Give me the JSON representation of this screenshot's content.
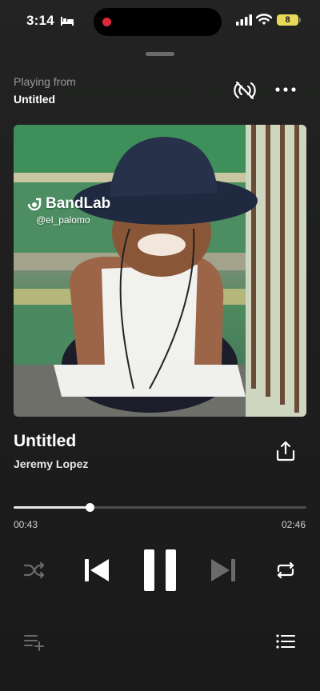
{
  "status_bar": {
    "time": "3:14",
    "battery": "8",
    "icons": [
      "bed-icon",
      "recording-dot",
      "cellular-signal-icon",
      "wifi-icon",
      "battery-icon"
    ]
  },
  "header": {
    "playing_from_label": "Playing from",
    "source_name": "Untitled",
    "icons": [
      "cast-off-icon",
      "more-options-icon"
    ]
  },
  "artwork": {
    "watermark_brand": "BandLab",
    "watermark_handle": "@el_palomo"
  },
  "track": {
    "title": "Untitled",
    "artist": "Jeremy Lopez"
  },
  "progress": {
    "elapsed": "00:43",
    "total": "02:46",
    "fraction": 0.26
  },
  "controls": {
    "icons": [
      "shuffle-icon",
      "previous-icon",
      "pause-icon",
      "next-icon",
      "repeat-icon",
      "add-to-queue-icon",
      "queue-list-icon",
      "share-icon"
    ],
    "next_enabled": false,
    "shuffle_enabled": false
  },
  "colors": {
    "background": "#1d1e1d",
    "progress_fill": "#e8e8e8",
    "recording_dot": "#e0263a",
    "battery": "#e7da5a",
    "disabled_icon": "#6b6b6b"
  }
}
